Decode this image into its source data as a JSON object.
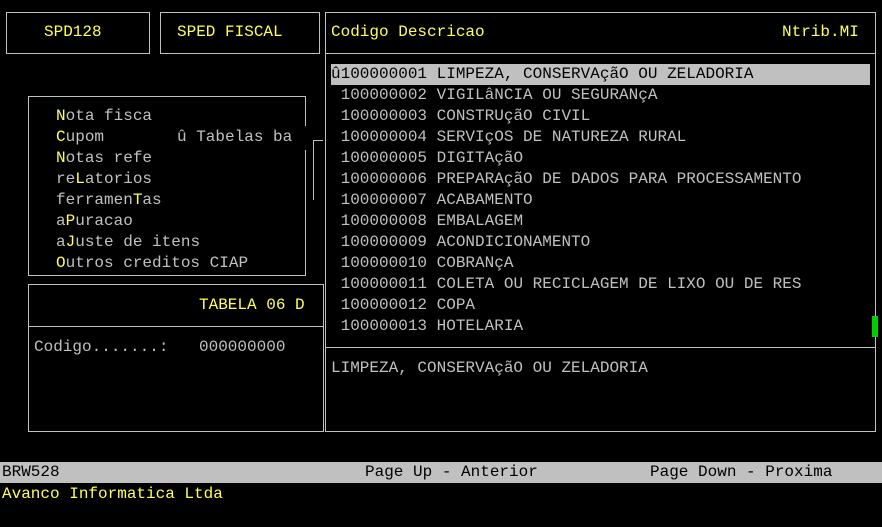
{
  "header": {
    "program_code": "SPD128",
    "module_title": "SPED FISCAL"
  },
  "menu": {
    "items": [
      {
        "hotkey_prefix": "",
        "hotkey": "N",
        "rest": "ota fisca"
      },
      {
        "hotkey_prefix": "",
        "hotkey": "C",
        "rest": "upom"
      },
      {
        "hotkey_prefix": "",
        "hotkey": "N",
        "rest": "otas refe"
      },
      {
        "hotkey_prefix": "re",
        "hotkey": "L",
        "rest": "atorios"
      },
      {
        "hotkey_prefix": "ferramen",
        "hotkey": "T",
        "rest": "as"
      },
      {
        "hotkey_prefix": "a",
        "hotkey": "P",
        "rest": "uracao"
      },
      {
        "hotkey_prefix": "a",
        "hotkey": "J",
        "rest": "uste de itens"
      },
      {
        "hotkey_prefix": "",
        "hotkey": "O",
        "rest": "utros creditos CIAP"
      }
    ],
    "submenu_label": "û Tabelas ba"
  },
  "form": {
    "title": "TABELA 06 D",
    "codigo_label": "Codigo.......:",
    "codigo_value": "000000000"
  },
  "lookup": {
    "header_left": "Codigo Descricao",
    "header_right": "Ntrib.MI",
    "rows": [
      {
        "code": "û100000001",
        "desc": "LIMPEZA, CONSERVAçãO OU ZELADORIA"
      },
      {
        "code": " 100000002",
        "desc": "VIGILâNCIA OU SEGURANçA"
      },
      {
        "code": " 100000003",
        "desc": "CONSTRUçãO CIVIL"
      },
      {
        "code": " 100000004",
        "desc": "SERVIçOS DE NATUREZA RURAL"
      },
      {
        "code": " 100000005",
        "desc": "DIGITAçãO"
      },
      {
        "code": " 100000006",
        "desc": "PREPARAçãO DE DADOS PARA PROCESSAMENTO"
      },
      {
        "code": " 100000007",
        "desc": "ACABAMENTO"
      },
      {
        "code": " 100000008",
        "desc": "EMBALAGEM"
      },
      {
        "code": " 100000009",
        "desc": "ACONDICIONAMENTO"
      },
      {
        "code": " 100000010",
        "desc": "COBRANçA"
      },
      {
        "code": " 100000011",
        "desc": "COLETA OU RECICLAGEM DE LIXO OU DE RES"
      },
      {
        "code": " 100000012",
        "desc": "COPA"
      },
      {
        "code": " 100000013",
        "desc": "HOTELARIA"
      }
    ],
    "detail_text": "LIMPEZA, CONSERVAçãO OU ZELADORIA"
  },
  "status": {
    "screen_id": "BRW528",
    "page_up": "Page Up - Anterior",
    "page_down": "Page Down - Proxima",
    "company": "Avanco Informatica Ltda"
  },
  "colors": {
    "background": "#000000",
    "highlight_text": "#ffff55",
    "normal_text": "#c0c0c0",
    "selection_bg": "#c0c0c0",
    "scroll_thumb": "#00d000"
  }
}
